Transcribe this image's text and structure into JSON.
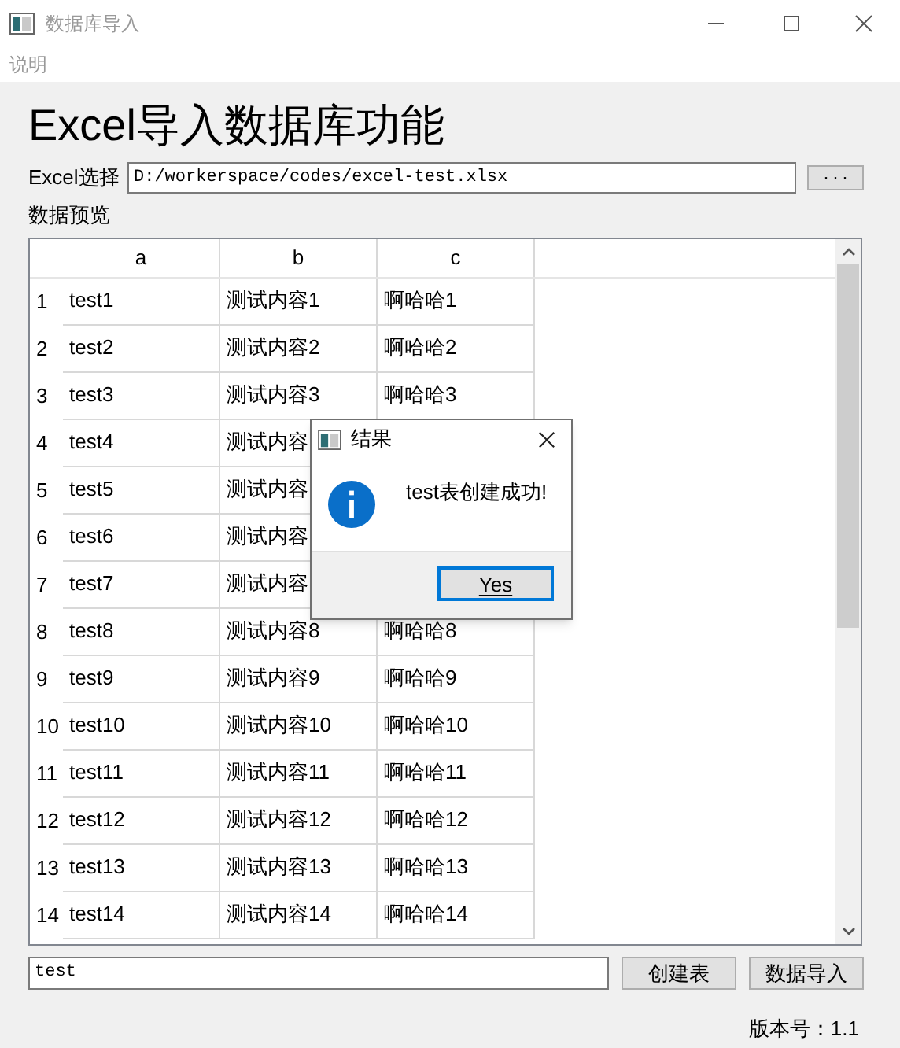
{
  "window": {
    "title": "数据库导入"
  },
  "menu": [
    "说明"
  ],
  "heading": "Excel导入数据库功能",
  "file_picker": {
    "label": "Excel选择",
    "value": "D:/workerspace/codes/excel-test.xlsx",
    "browse_button": "..."
  },
  "preview_label": "数据预览",
  "table": {
    "columns": [
      "a",
      "b",
      "c"
    ],
    "rows": [
      {
        "number": "1",
        "a": "test1",
        "b": "测试内容1",
        "c": "啊哈哈1"
      },
      {
        "number": "2",
        "a": "test2",
        "b": "测试内容2",
        "c": "啊哈哈2"
      },
      {
        "number": "3",
        "a": "test3",
        "b": "测试内容3",
        "c": "啊哈哈3"
      },
      {
        "number": "4",
        "a": "test4",
        "b": "测试内容"
      },
      {
        "number": "5",
        "a": "test5",
        "b": "测试内容"
      },
      {
        "number": "6",
        "a": "test6",
        "b": "测试内容"
      },
      {
        "number": "7",
        "a": "test7",
        "b": "测试内容"
      },
      {
        "number": "8",
        "a": "test8",
        "b": "测试内容8",
        "c": "啊哈哈8"
      },
      {
        "number": "9",
        "a": "test9",
        "b": "测试内容9",
        "c": "啊哈哈9"
      },
      {
        "number": "10",
        "a": "test10",
        "b": "测试内容10",
        "c": "啊哈哈10"
      },
      {
        "number": "11",
        "a": "test11",
        "b": "测试内容11",
        "c": "啊哈哈11"
      },
      {
        "number": "12",
        "a": "test12",
        "b": "测试内容12",
        "c": "啊哈哈12"
      },
      {
        "number": "13",
        "a": "test13",
        "b": "测试内容13",
        "c": "啊哈哈13"
      },
      {
        "number": "14",
        "a": "test14",
        "b": "测试内容14",
        "c": "啊哈哈14"
      }
    ]
  },
  "table_name_field": {
    "value": "test"
  },
  "buttons": [
    "创建表",
    "数据导入"
  ],
  "version": "版本号：1.1",
  "dialog": {
    "title": "结果",
    "message": "test表创建成功!",
    "button": "Yes"
  }
}
